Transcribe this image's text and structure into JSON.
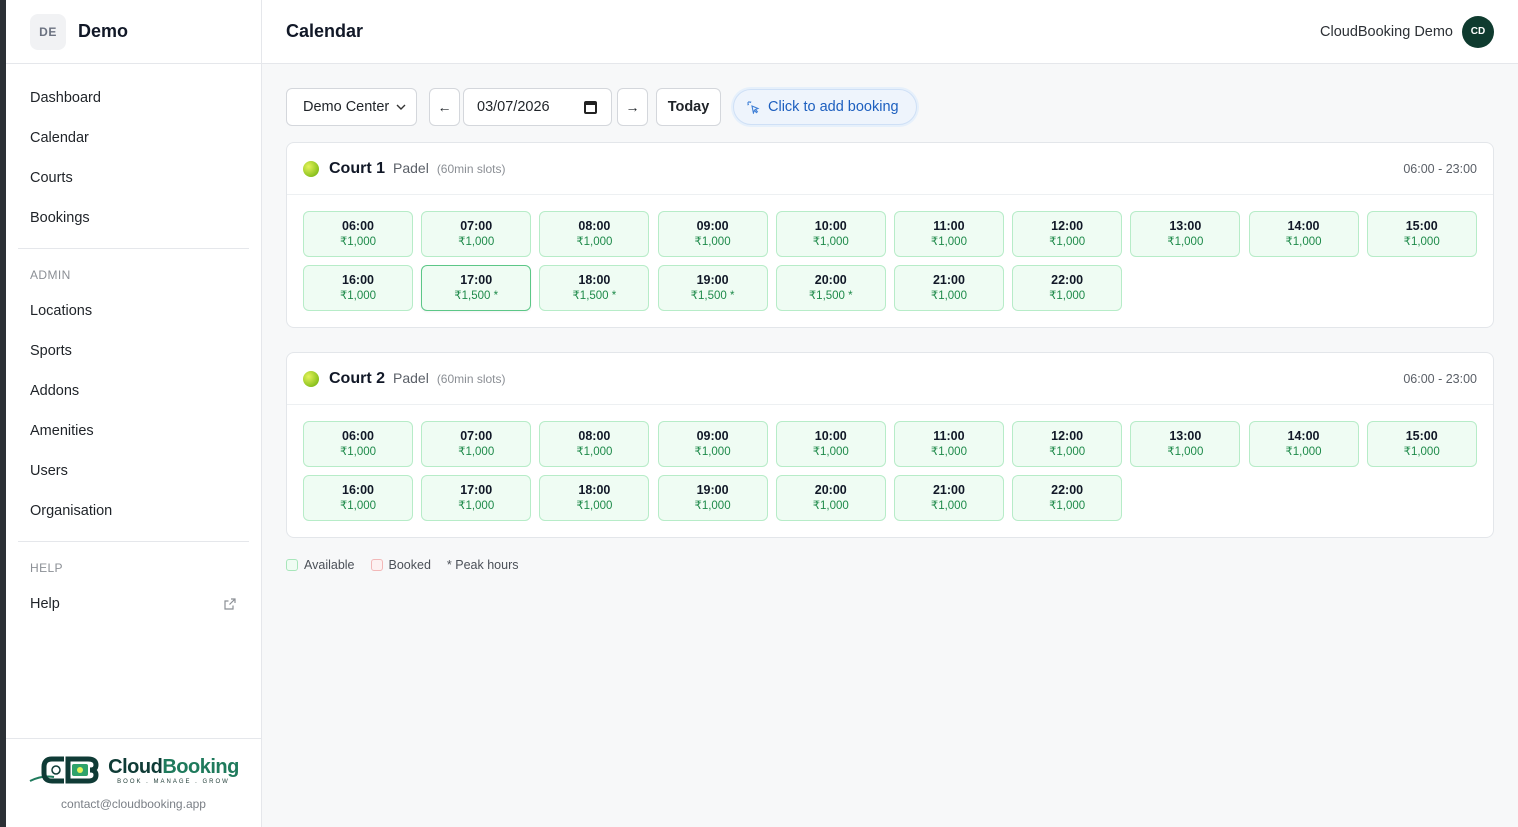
{
  "brand": {
    "badge": "DE",
    "name": "Demo"
  },
  "sidebar": {
    "items": [
      {
        "label": "Dashboard"
      },
      {
        "label": "Calendar"
      },
      {
        "label": "Courts"
      },
      {
        "label": "Bookings"
      }
    ],
    "admin_heading": "ADMIN",
    "admin_items": [
      {
        "label": "Locations"
      },
      {
        "label": "Sports"
      },
      {
        "label": "Addons"
      },
      {
        "label": "Amenities"
      },
      {
        "label": "Users"
      },
      {
        "label": "Organisation"
      }
    ],
    "help_heading": "HELP",
    "help_item": {
      "label": "Help",
      "icon": "external-link-icon"
    },
    "footer": {
      "logo_word_1": "Cloud",
      "logo_word_2": "Booking",
      "logo_tagline": "BOOK . MANAGE . GROW",
      "email": "contact@cloudbooking.app"
    }
  },
  "header": {
    "title": "Calendar",
    "user_name": "CloudBooking Demo",
    "avatar_initials": "CD"
  },
  "toolbar": {
    "location_value": "Demo Center",
    "prev_label": "←",
    "date_value": "03/07/2026",
    "next_label": "→",
    "today_label": "Today",
    "hint_label": "Click to add booking"
  },
  "courts": [
    {
      "name": "Court 1",
      "sport": "Padel",
      "slots_note": "(60min slots)",
      "hours": "06:00 - 23:00",
      "slots": [
        {
          "time": "06:00",
          "price": "₹1,000"
        },
        {
          "time": "07:00",
          "price": "₹1,000"
        },
        {
          "time": "08:00",
          "price": "₹1,000"
        },
        {
          "time": "09:00",
          "price": "₹1,000"
        },
        {
          "time": "10:00",
          "price": "₹1,000"
        },
        {
          "time": "11:00",
          "price": "₹1,000"
        },
        {
          "time": "12:00",
          "price": "₹1,000"
        },
        {
          "time": "13:00",
          "price": "₹1,000"
        },
        {
          "time": "14:00",
          "price": "₹1,000"
        },
        {
          "time": "15:00",
          "price": "₹1,000"
        },
        {
          "time": "16:00",
          "price": "₹1,000"
        },
        {
          "time": "17:00",
          "price": "₹1,500 *"
        },
        {
          "time": "18:00",
          "price": "₹1,500 *"
        },
        {
          "time": "19:00",
          "price": "₹1,500 *"
        },
        {
          "time": "20:00",
          "price": "₹1,500 *"
        },
        {
          "time": "21:00",
          "price": "₹1,000"
        },
        {
          "time": "22:00",
          "price": "₹1,000"
        }
      ]
    },
    {
      "name": "Court 2",
      "sport": "Padel",
      "slots_note": "(60min slots)",
      "hours": "06:00 - 23:00",
      "slots": [
        {
          "time": "06:00",
          "price": "₹1,000"
        },
        {
          "time": "07:00",
          "price": "₹1,000"
        },
        {
          "time": "08:00",
          "price": "₹1,000"
        },
        {
          "time": "09:00",
          "price": "₹1,000"
        },
        {
          "time": "10:00",
          "price": "₹1,000"
        },
        {
          "time": "11:00",
          "price": "₹1,000"
        },
        {
          "time": "12:00",
          "price": "₹1,000"
        },
        {
          "time": "13:00",
          "price": "₹1,000"
        },
        {
          "time": "14:00",
          "price": "₹1,000"
        },
        {
          "time": "15:00",
          "price": "₹1,000"
        },
        {
          "time": "16:00",
          "price": "₹1,000"
        },
        {
          "time": "17:00",
          "price": "₹1,000"
        },
        {
          "time": "18:00",
          "price": "₹1,000"
        },
        {
          "time": "19:00",
          "price": "₹1,000"
        },
        {
          "time": "20:00",
          "price": "₹1,000"
        },
        {
          "time": "21:00",
          "price": "₹1,000"
        },
        {
          "time": "22:00",
          "price": "₹1,000"
        }
      ]
    }
  ],
  "legend": {
    "available": "Available",
    "booked": "Booked",
    "peak": "* Peak hours"
  },
  "colors": {
    "slot_available_bg": "#effcf3",
    "slot_price": "#1e8a4a",
    "accent_blue": "#1d5fbf",
    "avatar_bg": "#0f3b2f"
  }
}
